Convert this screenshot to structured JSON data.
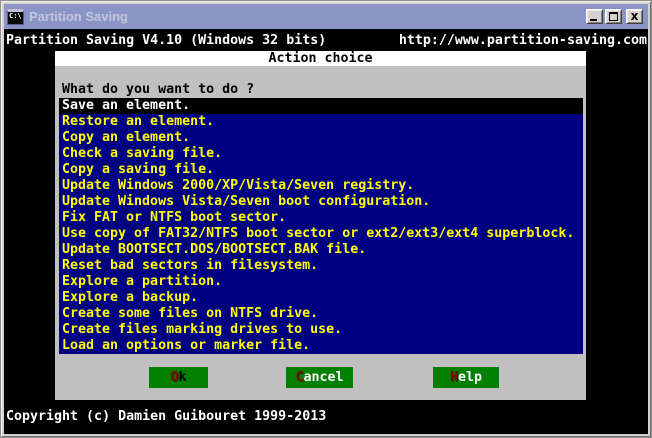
{
  "window": {
    "title": "Partition Saving",
    "icon_glyph": "C:\\",
    "controls": {
      "minimize": "minimize-icon",
      "maximize": "maximize-icon",
      "close_glyph": "x"
    }
  },
  "console": {
    "header_left": "Partition Saving V4.10 (Windows 32 bits)",
    "header_right": "http://www.partition-saving.com",
    "copyright": "Copyright (c) Damien Guibouret 1999-2013"
  },
  "dialog": {
    "title": "Action choice",
    "question": "What do you want to do ?",
    "selected_index": 0,
    "items": [
      "Save an element.",
      "Restore an element.",
      "Copy an element.",
      "Check a saving file.",
      "Copy a saving file.",
      "Update Windows 2000/XP/Vista/Seven registry.",
      "Update Windows Vista/Seven boot configuration.",
      "Fix FAT or NTFS boot sector.",
      "Use copy of FAT32/NTFS boot sector or ext2/ext3/ext4 superblock.",
      "Update BOOTSECT.DOS/BOOTSECT.BAK file.",
      "Reset bad sectors in filesystem.",
      "Explore a partition.",
      "Explore a backup.",
      "Create some files on NTFS drive.",
      "Create files marking drives to use.",
      "Load an options or marker file."
    ],
    "buttons": [
      {
        "hotkey": "O",
        "rest": "k"
      },
      {
        "hotkey": "C",
        "rest": "ancel"
      },
      {
        "hotkey": "H",
        "rest": "elp"
      }
    ]
  },
  "colors": {
    "titlebar_bg": "#8B94C6",
    "titlebar_text": "#C2C7DC",
    "console_bg": "#000000",
    "console_text": "#FFFFFF",
    "dialog_bg": "#C0C0C0",
    "dialog_title_bg": "#FFFFFF",
    "list_bg": "#000080",
    "list_item_text": "#FFFF00",
    "selected_bg": "#000000",
    "selected_text": "#FFFFFF",
    "button_bg": "#008000",
    "button_hotkey": "#8B0000"
  }
}
